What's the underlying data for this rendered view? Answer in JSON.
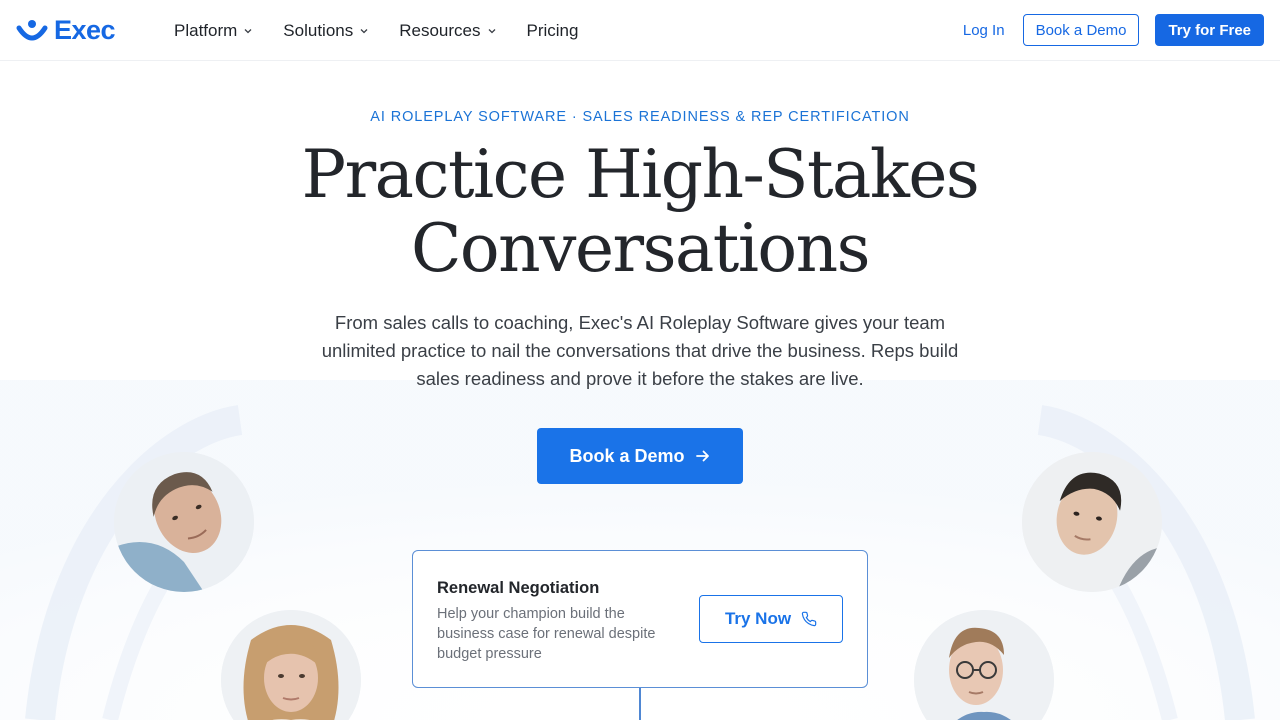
{
  "brand": {
    "name": "Exec",
    "accent": "#1668e3"
  },
  "nav": {
    "items": [
      {
        "label": "Platform",
        "has_dropdown": true
      },
      {
        "label": "Solutions",
        "has_dropdown": true
      },
      {
        "label": "Resources",
        "has_dropdown": true
      },
      {
        "label": "Pricing",
        "has_dropdown": false
      }
    ],
    "login_label": "Log In",
    "demo_label": "Book a Demo",
    "trial_label": "Try for Free"
  },
  "hero": {
    "eyebrow": "AI ROLEPLAY SOFTWARE · SALES READINESS & REP CERTIFICATION",
    "headline_line1": "Practice High-Stakes",
    "headline_line2": "Conversations",
    "subtext": "From sales calls to coaching, Exec's AI Roleplay Software gives your team unlimited practice to nail the conversations that drive the business. Reps build sales readiness and prove it before the stakes are live.",
    "cta_label": "Book a Demo",
    "cta_icon": "arrow-right-icon"
  },
  "scenario_card": {
    "title": "Renewal Negotiation",
    "description": "Help your champion build the business case for renewal despite budget pressure",
    "button_label": "Try Now",
    "button_icon": "phone-icon"
  },
  "avatars": [
    {
      "name": "avatar-man-tilted"
    },
    {
      "name": "avatar-woman-blonde"
    },
    {
      "name": "avatar-man-asian"
    },
    {
      "name": "avatar-man-glasses"
    }
  ]
}
